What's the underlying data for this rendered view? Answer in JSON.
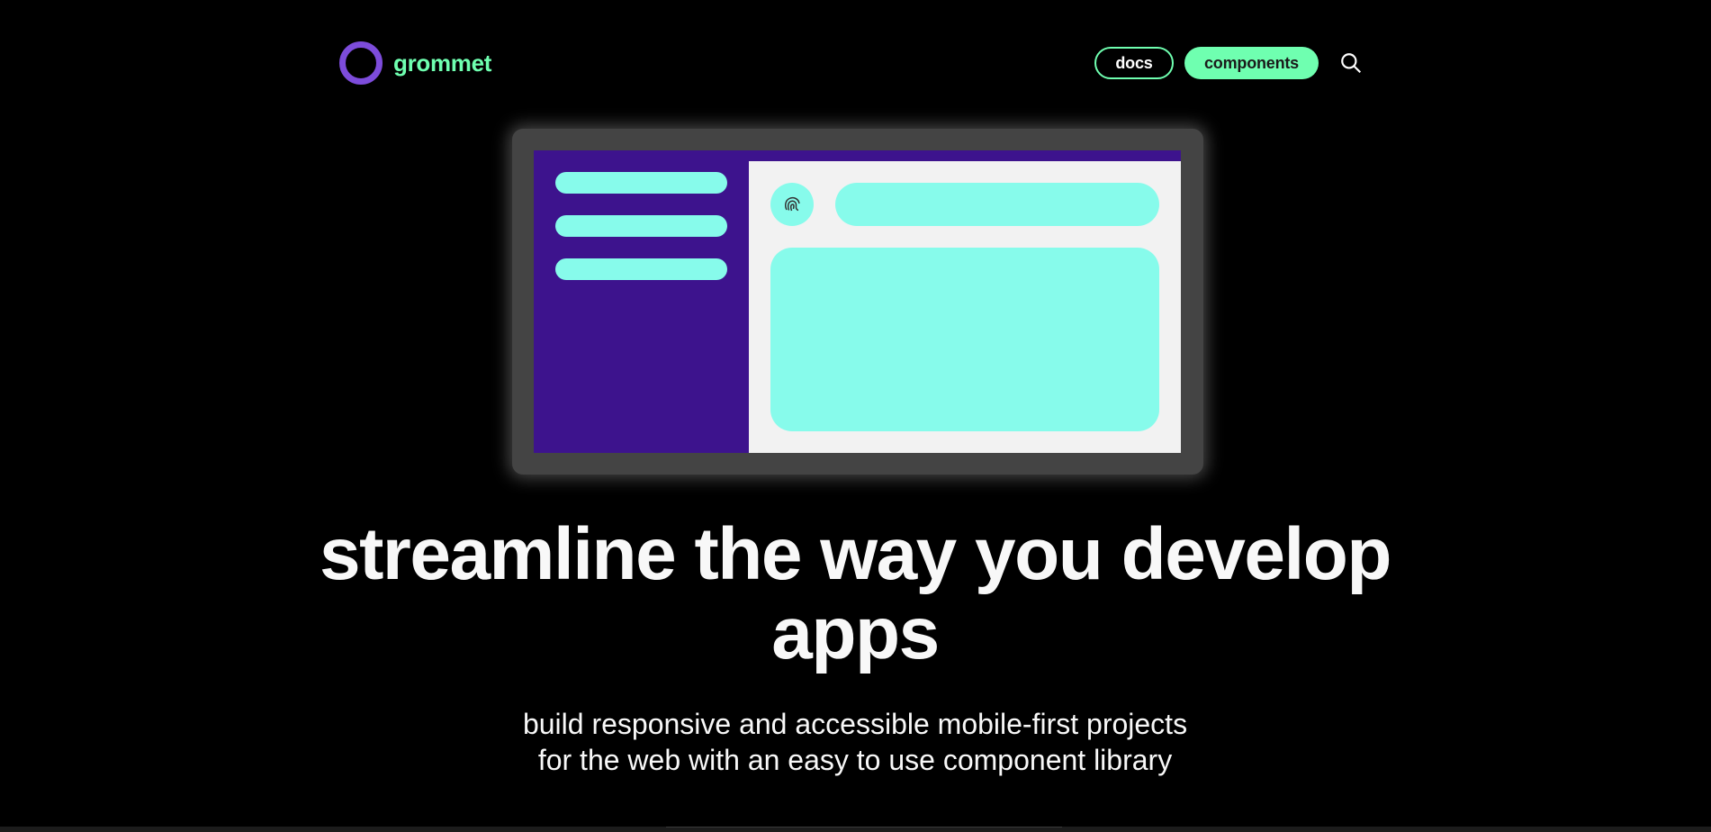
{
  "header": {
    "brand_name": "grommet",
    "nav": {
      "docs_label": "docs",
      "components_label": "components"
    },
    "search_icon": "search-icon"
  },
  "illustration": {
    "avatar_icon": "fingerprint-icon"
  },
  "hero": {
    "headline": "streamline the way you develop apps",
    "subhead_line1": "build responsive and accessible mobile-first projects",
    "subhead_line2": "for the web with an easy to use component library"
  },
  "colors": {
    "background": "#000000",
    "brand_accent": "#6fffb0",
    "logo_ring": "#7d4cdb",
    "illustration_sidebar": "#3d138d",
    "illustration_blocks": "#87fbeb",
    "illustration_frame": "#444444",
    "text": "#f8f8f8"
  }
}
